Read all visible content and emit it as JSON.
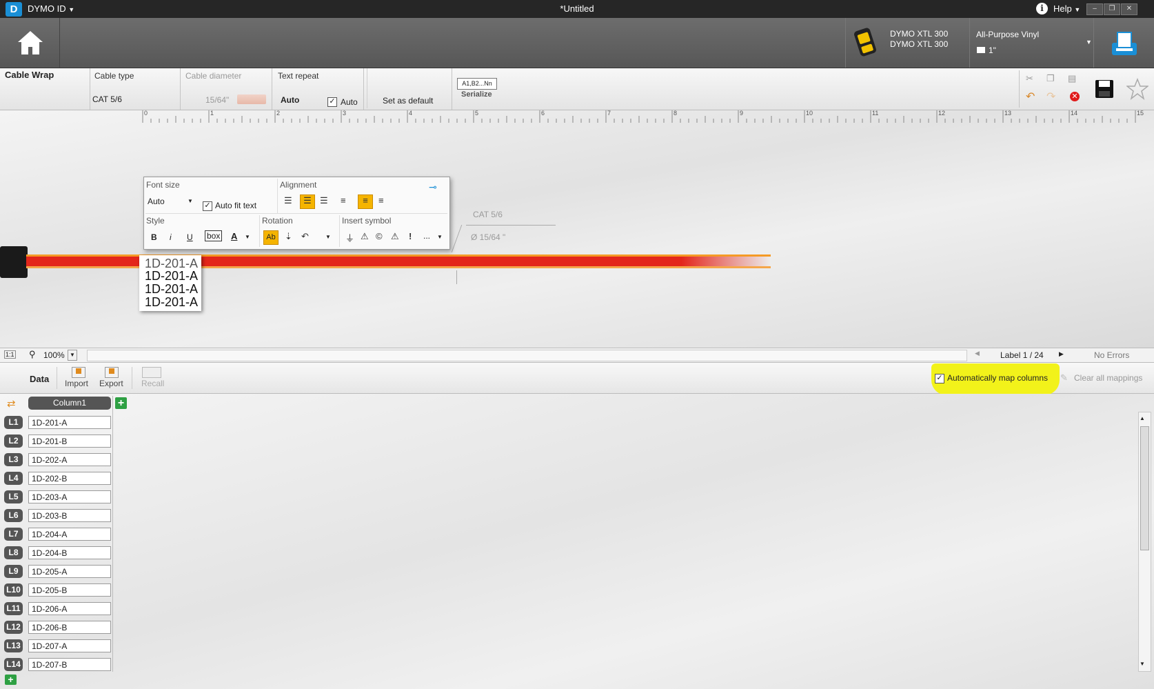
{
  "titlebar": {
    "logo": "D",
    "app_name": "DYMO ID",
    "document_title": "*Untitled",
    "help_label": "Help"
  },
  "header": {
    "printer_name_1": "DYMO XTL 300",
    "printer_name_2": "DYMO XTL 300",
    "label_type": "All-Purpose Vinyl",
    "label_size": "1\""
  },
  "toolbar": {
    "template_name": "Cable Wrap",
    "cable_type_label": "Cable type",
    "cable_type_value": "CAT 5/6",
    "cable_diameter_label": "Cable diameter",
    "cable_diameter_value": "15/64\"",
    "text_repeat_label": "Text repeat",
    "text_repeat_value": "Auto",
    "text_repeat_auto_label": "Auto",
    "set_default_label": "Set as default",
    "serialize_box": "A1,B2...Nn",
    "serialize_label": "Serialize"
  },
  "ruler": {
    "ticks": [
      "0",
      "1",
      "2",
      "3",
      "4",
      "5",
      "6",
      "7",
      "8",
      "9",
      "10",
      "11",
      "12",
      "13",
      "14",
      "15"
    ]
  },
  "format_panel": {
    "font_size_label": "Font size",
    "font_size_value": "Auto",
    "auto_fit_label": "Auto fit text",
    "alignment_label": "Alignment",
    "style_label": "Style",
    "bold": "B",
    "italic": "i",
    "underline": "U",
    "box": "box",
    "font_color": "A",
    "rotation_label": "Rotation",
    "rotation_ab": "Ab",
    "insert_symbol_label": "Insert symbol",
    "more_symbols": "..."
  },
  "canvas": {
    "cable_annotation_type": "CAT 5/6",
    "cable_annotation_diameter": "Ø 15/64 \"",
    "label_lines": [
      "1D-201-A",
      "1D-201-A",
      "1D-201-A",
      "1D-201-A"
    ]
  },
  "statusbar": {
    "zoom": "100%",
    "label_counter": "Label 1 / 24",
    "errors": "No Errors"
  },
  "data_toolbar": {
    "data_label": "Data",
    "import_label": "Import",
    "export_label": "Export",
    "recall_label": "Recall",
    "auto_map_label": "Automatically map columns",
    "clear_mappings_label": "Clear all mappings"
  },
  "table": {
    "column_header": "Column1",
    "rows": [
      {
        "tag": "L1",
        "value": "1D-201-A"
      },
      {
        "tag": "L2",
        "value": "1D-201-B"
      },
      {
        "tag": "L3",
        "value": "1D-202-A"
      },
      {
        "tag": "L4",
        "value": "1D-202-B"
      },
      {
        "tag": "L5",
        "value": "1D-203-A"
      },
      {
        "tag": "L6",
        "value": "1D-203-B"
      },
      {
        "tag": "L7",
        "value": "1D-204-A"
      },
      {
        "tag": "L8",
        "value": "1D-204-B"
      },
      {
        "tag": "L9",
        "value": "1D-205-A"
      },
      {
        "tag": "L10",
        "value": "1D-205-B"
      },
      {
        "tag": "L11",
        "value": "1D-206-A"
      },
      {
        "tag": "L12",
        "value": "1D-206-B"
      },
      {
        "tag": "L13",
        "value": "1D-207-A"
      },
      {
        "tag": "L14",
        "value": "1D-207-B"
      }
    ]
  },
  "colors": {
    "titlebar": "#262626",
    "header": "#5f5f5f",
    "accent_orange": "#f5b400",
    "highlight_yellow": "#f2f21a",
    "cable_red": "#e3261b",
    "add_green": "#2ea043"
  }
}
